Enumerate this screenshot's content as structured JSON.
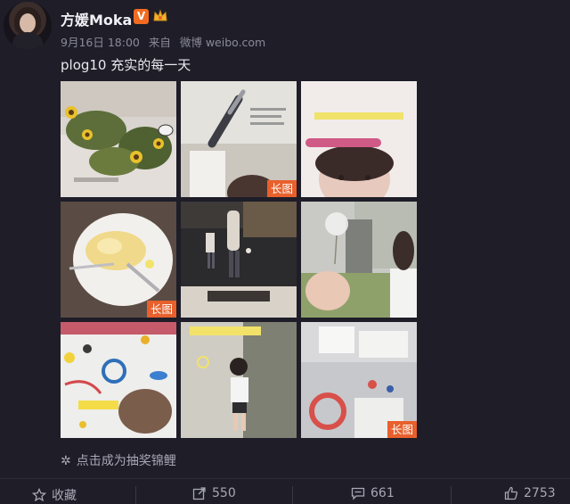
{
  "user": {
    "name": "方媛Moka",
    "verified_badge": "V",
    "timestamp": "9月16日 18:00",
    "source_prefix": "来自",
    "source": "微博 weibo.com"
  },
  "post": {
    "text": "plog10 充实的每一天",
    "images": [
      {
        "id": "sunflowers-garden",
        "badge": ""
      },
      {
        "id": "pen-closeup",
        "badge": "长图"
      },
      {
        "id": "selfie-glasses",
        "badge": ""
      },
      {
        "id": "omelette-plate",
        "badge": "长图"
      },
      {
        "id": "night-walk",
        "badge": ""
      },
      {
        "id": "dandelion",
        "badge": ""
      },
      {
        "id": "painting-table",
        "badge": ""
      },
      {
        "id": "child-walking",
        "badge": ""
      },
      {
        "id": "gift-boxes",
        "badge": "长图"
      }
    ]
  },
  "lottery": {
    "label": "点击成为抽奖锦鲤"
  },
  "actions": {
    "favorite_label": "收藏",
    "repost_count": "550",
    "comment_count": "661",
    "like_count": "2753"
  },
  "colors": {
    "background": "#1e1d28",
    "accent_badge": "#e8602c",
    "verified": "#f26b21"
  }
}
